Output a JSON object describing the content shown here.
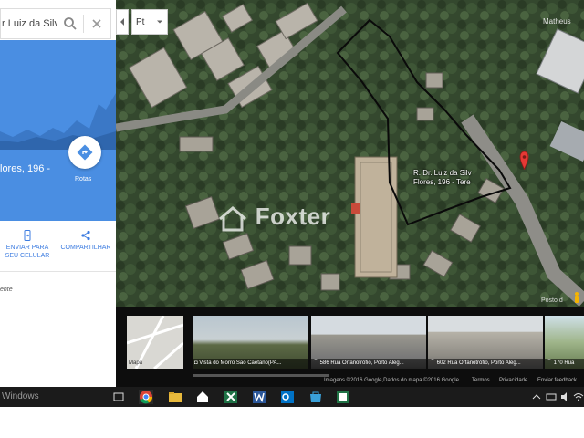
{
  "search": {
    "value": "r Luiz da Silv"
  },
  "header": {
    "lang": "Pt"
  },
  "place": {
    "address_line": "lores, 196 -",
    "routes_label": "Rotas"
  },
  "actions": {
    "send_line1": "ENVIAR PARA",
    "send_line2": "SEU CELULAR",
    "share_label": "COMPARTILHAR"
  },
  "side": {
    "partial_text": "ente"
  },
  "map": {
    "user_name": "Matheus",
    "pin_line1": "R. Dr. Luiz da Silv",
    "pin_line2": "Flores, 196 - Tere",
    "watermark": "Foxter",
    "scale_text": "Posto d"
  },
  "photos": [
    {
      "label": "Mapa"
    },
    {
      "label": "Vista do Morro São Caetano(PA..."
    },
    {
      "label": "586 Rua Orfanotrófio, Porto Aleg..."
    },
    {
      "label": "602 Rua Orfanotrófio, Porto Aleg..."
    },
    {
      "label": "170 Rua"
    }
  ],
  "footer": {
    "credits": "Imagens ©2016 Google,Dados do mapa ©2016 Google",
    "terms": "Termos",
    "privacy": "Privacidade",
    "feedback": "Enviar feedback"
  },
  "taskbar": {
    "windows_label": "Windows"
  },
  "colors": {
    "accent": "#4a8ee2",
    "pin": "#e53935"
  }
}
